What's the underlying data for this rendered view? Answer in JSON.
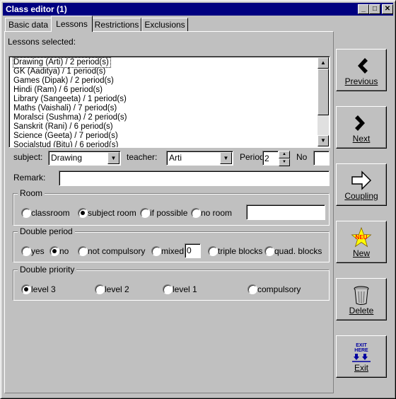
{
  "window": {
    "title": "Class editor (1)"
  },
  "title_buttons": {
    "minimize": "_",
    "maximize": "□",
    "close": "✕"
  },
  "tabs": [
    {
      "label": "Basic data",
      "active": false
    },
    {
      "label": "Lessons",
      "active": true
    },
    {
      "label": "Restrictions",
      "active": false
    },
    {
      "label": "Exclusions",
      "active": false
    }
  ],
  "lessons": {
    "label": "Lessons selected:",
    "items": [
      "Drawing (Arti) / 2 period(s)",
      "GK (Aaditya) / 1 period(s)",
      "Games (Dipak) / 2 period(s)",
      "Hindi (Ram) / 6 period(s)",
      "Library (Sangeeta) / 1 period(s)",
      "Maths (Vaishali) / 7 period(s)",
      "Moralsci (Sushma) / 2 period(s)",
      "Sanskrit (Rani) / 6 period(s)",
      "Science (Geeta) / 7 period(s)",
      "Socialstud (Bitu) / 6 period(s)"
    ]
  },
  "fields": {
    "subject_label": "subject:",
    "subject_value": "Drawing",
    "teacher_label": "teacher:",
    "teacher_value": "Arti",
    "period_label": "Period:",
    "period_value": "2",
    "no_label": "No",
    "no_value": "",
    "remark_label": "Remark:",
    "remark_value": ""
  },
  "room": {
    "title": "Room",
    "options": [
      "classroom",
      "subject room",
      "if possible",
      "no room"
    ],
    "selected": "subject room",
    "text_value": ""
  },
  "double_period": {
    "title": "Double period",
    "options": [
      "yes",
      "no",
      "not compulsory",
      "mixed",
      "triple blocks",
      "quad. blocks"
    ],
    "selected": "no",
    "mixed_value": "0"
  },
  "double_priority": {
    "title": "Double priority",
    "options": [
      "level 3",
      "level 2",
      "level 1",
      "compulsory"
    ],
    "selected": "level 3"
  },
  "buttons": {
    "previous": "Previous",
    "next": "Next",
    "coupling": "Coupling",
    "new": "New",
    "new_badge": "NEU",
    "delete": "Delete",
    "exit": "Exit",
    "exit_icon_text_1": "EXIT",
    "exit_icon_text_2": "HERE"
  },
  "icons": {
    "previous": "chevron-left-icon",
    "next": "chevron-right-icon",
    "coupling": "arrow-right-icon",
    "new": "star-icon",
    "delete": "trash-can-icon",
    "exit": "exit-sign-icon"
  },
  "colors": {
    "titlebar": "#000080",
    "face": "#c0c0c0",
    "exit_blue": "#0000a0",
    "star_yellow": "#ffff00",
    "star_red": "#ff0000"
  }
}
